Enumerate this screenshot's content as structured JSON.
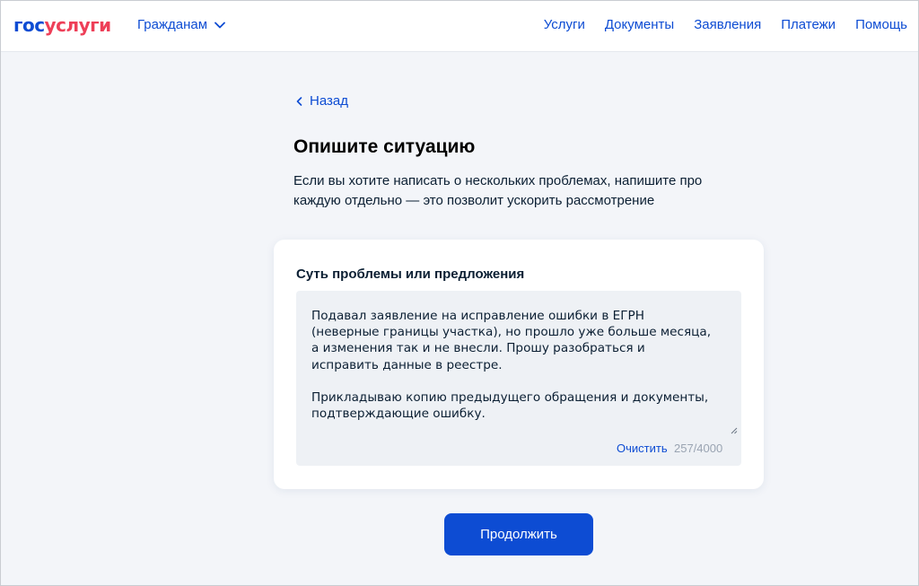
{
  "header": {
    "logo_part1": "гос",
    "logo_part2": "услуги",
    "audience_label": "Гражданам",
    "nav": [
      "Услуги",
      "Документы",
      "Заявления",
      "Платежи",
      "Помощь"
    ]
  },
  "page": {
    "back_label": "Назад",
    "title": "Опишите ситуацию",
    "description": "Если вы хотите написать о нескольких проблемах, напишите про каждую отдельно — это позволит ускорить рассмотрение"
  },
  "form": {
    "field_label": "Суть проблемы или предложения",
    "value": "Подавал заявление на исправление ошибки в ЕГРН (неверные границы участка), но прошло уже больше месяца, а изменения так и не внесли. Прошу разобраться и исправить данные в реестре.\n\nПрикладываю копию предыдущего обращения и документы, подтверждающие ошибку.",
    "clear_label": "Очистить",
    "counter": "257/4000"
  },
  "actions": {
    "continue_label": "Продолжить"
  },
  "colors": {
    "brand_blue": "#0d4cd3",
    "brand_red": "#ee3f58",
    "page_bg": "#f3f5f9"
  },
  "icons": {
    "audience_toggle": "chevron-down-icon",
    "back": "chevron-left-icon",
    "resize": "resize-handle-icon"
  }
}
